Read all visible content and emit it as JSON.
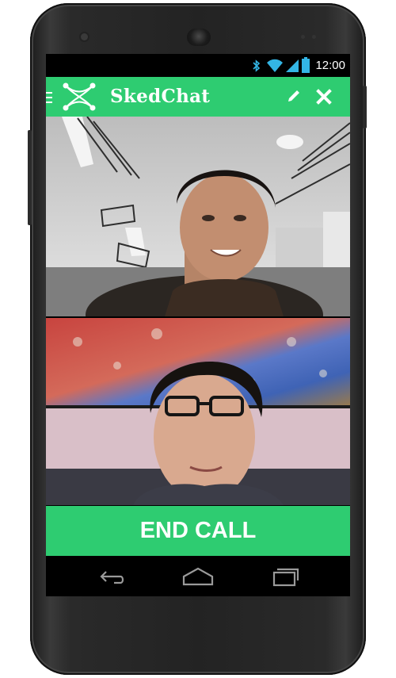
{
  "status_bar": {
    "time": "12:00",
    "icons": [
      "bluetooth-icon",
      "wifi-icon",
      "signal-icon",
      "battery-icon"
    ]
  },
  "action_bar": {
    "title": "SkedChat",
    "icons": [
      "menu-icon",
      "skedchat-logo-icon",
      "edit-icon",
      "close-icon"
    ]
  },
  "call": {
    "end_call_label": "END CALL"
  },
  "nav_bar": {
    "icons": [
      "back-icon",
      "home-icon",
      "recent-apps-icon"
    ]
  },
  "colors": {
    "accent": "#2ecc71",
    "status_icons": "#33b5e5"
  }
}
